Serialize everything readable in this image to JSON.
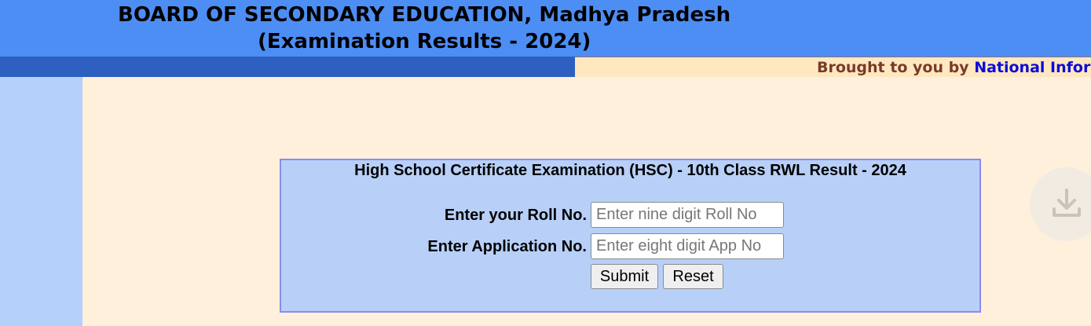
{
  "header": {
    "title": "BOARD OF SECONDARY EDUCATION, Madhya Pradesh",
    "subtitle": "(Examination Results - 2024)"
  },
  "banner": {
    "text": "Brought to you by ",
    "link_text": "National Informa"
  },
  "form": {
    "title": "High School Certificate Examination (HSC) - 10th Class RWL Result - 2024",
    "roll_label": "Enter your Roll No.",
    "roll_placeholder": "Enter nine digit Roll No",
    "app_label": "Enter Application No.",
    "app_placeholder": "Enter eight digit App No",
    "submit_label": "Submit",
    "reset_label": "Reset"
  },
  "icons": {
    "download": "download-icon"
  },
  "colors": {
    "header_bg": "#4d8ef5",
    "bar_dark": "#2d60c0",
    "page_bg": "#fff0dc",
    "form_bg": "#b8d0f8",
    "link": "#0c0cd8"
  }
}
